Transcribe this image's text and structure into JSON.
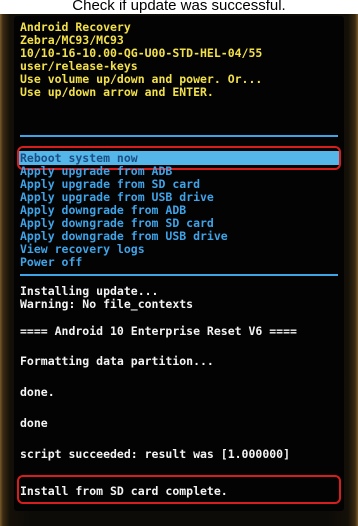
{
  "caption": "Check if update was successful.",
  "header_lines": [
    "Android Recovery",
    "Zebra/MC93/MC93",
    "10/10-16-10.00-QG-U00-STD-HEL-04/55",
    "user/release-keys",
    "Use volume up/down and power. Or...",
    "Use up/down arrow and ENTER."
  ],
  "menu": {
    "selected": "Reboot system now",
    "items": [
      "Apply upgrade from ADB",
      "Apply upgrade from SD card",
      "Apply upgrade from USB drive",
      "Apply downgrade from ADB",
      "Apply downgrade from SD card",
      "Apply downgrade from USB drive",
      "View recovery logs",
      "Power off"
    ]
  },
  "log": {
    "installing": "Installing update...",
    "warning": "Warning: No file_contexts",
    "banner": "==== Android 10 Enterprise Reset V6 ====",
    "formatting": "Formatting data partition...",
    "done1": "done.",
    "done2": "done",
    "script": "script succeeded: result was [1.000000]",
    "complete": "Install from SD card complete."
  },
  "colors": {
    "header": "#f2e04a",
    "menu": "#3fa3e8",
    "selection": "#55b6ea",
    "log": "#f4f4f4",
    "highlight": "#d71e1e"
  }
}
